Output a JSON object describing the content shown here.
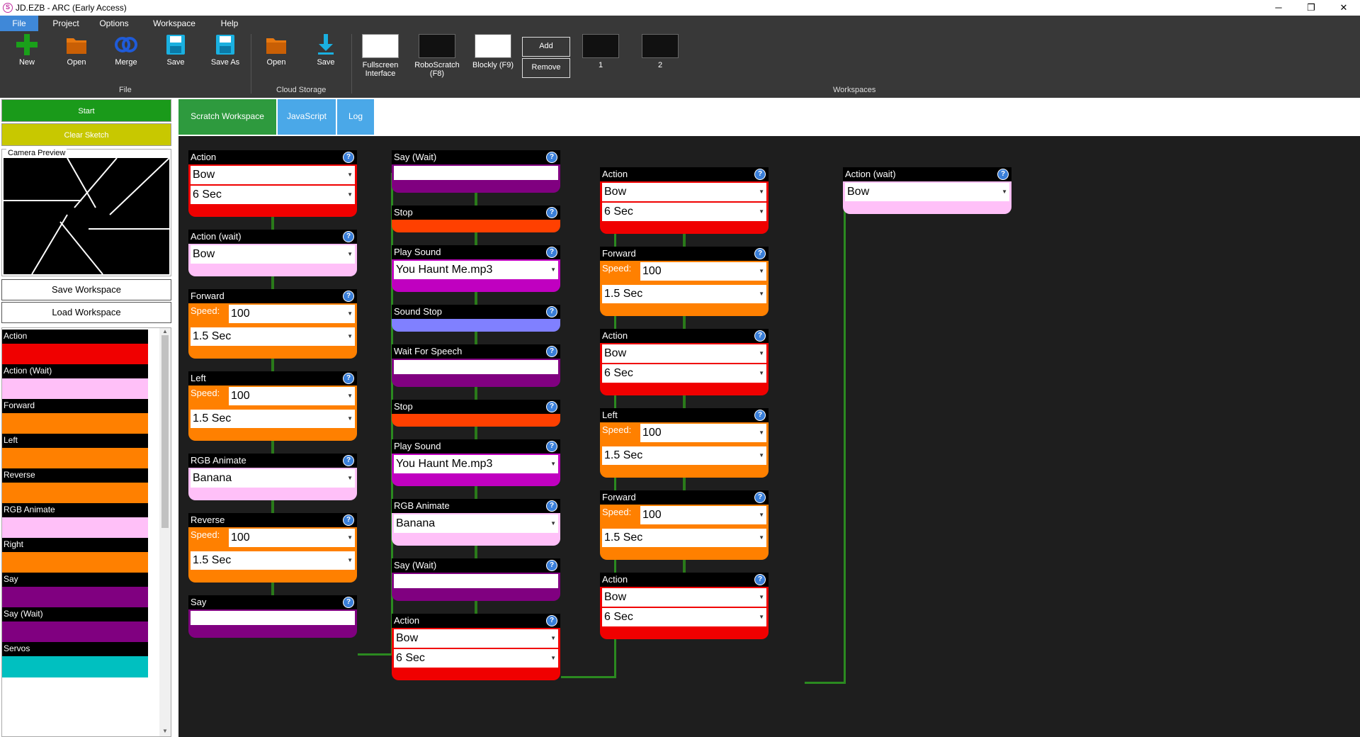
{
  "window": {
    "title": "JD.EZB - ARC (Early Access)",
    "minimize": "─",
    "maximize": "❐",
    "close": "✕"
  },
  "menu": [
    "File",
    "Project",
    "Options",
    "Workspace",
    "Help"
  ],
  "ribbon": {
    "file_buttons": [
      "New",
      "Open",
      "Merge",
      "Save",
      "Save As"
    ],
    "file_group": "File",
    "cloud_buttons": [
      "Open",
      "Save"
    ],
    "cloud_group": "Cloud Storage",
    "interface_buttons": [
      {
        "label": "Fullscreen Interface"
      },
      {
        "label": "RoboScratch (F8)"
      },
      {
        "label": "Blockly (F9)"
      }
    ],
    "add_label": "Add",
    "remove_label": "Remove",
    "workspaces": [
      "1",
      "2"
    ],
    "workspaces_group": "Workspaces",
    "icons": [
      "plus-icon",
      "folder-icon",
      "merge-icon",
      "floppy-icon",
      "floppy-icon",
      "folder-icon",
      "download-arrow-icon"
    ],
    "colors": {
      "ribbon": "#383838",
      "green": "#1aa01a",
      "orange": "#e8780f",
      "blue": "#1f5bd8",
      "cyan": "#1ab0e0"
    }
  },
  "left": {
    "start": "Start",
    "clear_sketch": "Clear Sketch",
    "camera_label": "Camera Preview",
    "save_workspace": "Save Workspace",
    "load_workspace": "Load Workspace",
    "palette": [
      {
        "label": "Action",
        "color": "#f00000"
      },
      {
        "label": "Action (Wait)",
        "color": "#ffc0f8"
      },
      {
        "label": "Forward",
        "color": "#ff8000"
      },
      {
        "label": "Left",
        "color": "#ff8000"
      },
      {
        "label": "Reverse",
        "color": "#ff8000"
      },
      {
        "label": "RGB Animate",
        "color": "#ffc0f8"
      },
      {
        "label": "Right",
        "color": "#ff8000"
      },
      {
        "label": "Say",
        "color": "#800080"
      },
      {
        "label": "Say (Wait)",
        "color": "#800080"
      },
      {
        "label": "Servos",
        "color": "#00c0c0"
      }
    ]
  },
  "tabs": [
    {
      "label": "Scratch Workspace",
      "color": "#2e9a3e"
    },
    {
      "label": "JavaScript",
      "color": "#4aa8e8"
    },
    {
      "label": "Log",
      "color": "#4aa8e8"
    }
  ],
  "speed_label": "Speed:",
  "blocks": {
    "c1": [
      {
        "title": "Action",
        "color": "#f00000",
        "fields": [
          "Bow",
          "6 Sec"
        ]
      },
      {
        "title": "Action (wait)",
        "color": "#ffc0f8",
        "fields": [
          "Bow"
        ]
      },
      {
        "title": "Forward",
        "color": "#ff8000",
        "speed": "100",
        "fields": [
          "1.5 Sec"
        ]
      },
      {
        "title": "Left",
        "color": "#ff8000",
        "speed": "100",
        "fields": [
          "1.5 Sec"
        ]
      },
      {
        "title": "RGB Animate",
        "color": "#ffc0f8",
        "fields": [
          "Banana"
        ]
      },
      {
        "title": "Reverse",
        "color": "#ff8000",
        "speed": "100",
        "fields": [
          "1.5 Sec"
        ]
      },
      {
        "title": "Say",
        "color": "#800080",
        "fields": [
          ""
        ]
      }
    ],
    "c2": [
      {
        "title": "Say (Wait)",
        "color": "#800080",
        "fields": [
          ""
        ]
      },
      {
        "title": "Stop",
        "color": "#ff4000",
        "fields": []
      },
      {
        "title": "Play Sound",
        "color": "#c000c0",
        "fields": [
          "You Haunt Me.mp3"
        ]
      },
      {
        "title": "Sound Stop",
        "color": "#8080ff",
        "fields": []
      },
      {
        "title": "Wait For Speech",
        "color": "#800080",
        "fields": [
          ""
        ]
      },
      {
        "title": "Stop",
        "color": "#ff4000",
        "fields": []
      },
      {
        "title": "Play Sound",
        "color": "#c000c0",
        "fields": [
          "You Haunt Me.mp3"
        ]
      },
      {
        "title": "RGB Animate",
        "color": "#ffc0f8",
        "fields": [
          "Banana"
        ]
      },
      {
        "title": "Say (Wait)",
        "color": "#800080",
        "fields": [
          ""
        ]
      },
      {
        "title": "Action",
        "color": "#f00000",
        "fields": [
          "Bow",
          "6 Sec"
        ]
      }
    ],
    "c3": [
      {
        "title": "Action",
        "color": "#f00000",
        "fields": [
          "Bow",
          "6 Sec"
        ]
      },
      {
        "title": "Forward",
        "color": "#ff8000",
        "speed": "100",
        "fields": [
          "1.5 Sec"
        ]
      },
      {
        "title": "Action",
        "color": "#f00000",
        "fields": [
          "Bow",
          "6 Sec"
        ]
      },
      {
        "title": "Left",
        "color": "#ff8000",
        "speed": "100",
        "fields": [
          "1.5 Sec"
        ]
      },
      {
        "title": "Forward",
        "color": "#ff8000",
        "speed": "100",
        "fields": [
          "1.5 Sec"
        ]
      },
      {
        "title": "Action",
        "color": "#f00000",
        "fields": [
          "Bow",
          "6 Sec"
        ]
      }
    ],
    "c4": [
      {
        "title": "Action (wait)",
        "color": "#ffc0f8",
        "fields": [
          "Bow"
        ]
      }
    ]
  }
}
